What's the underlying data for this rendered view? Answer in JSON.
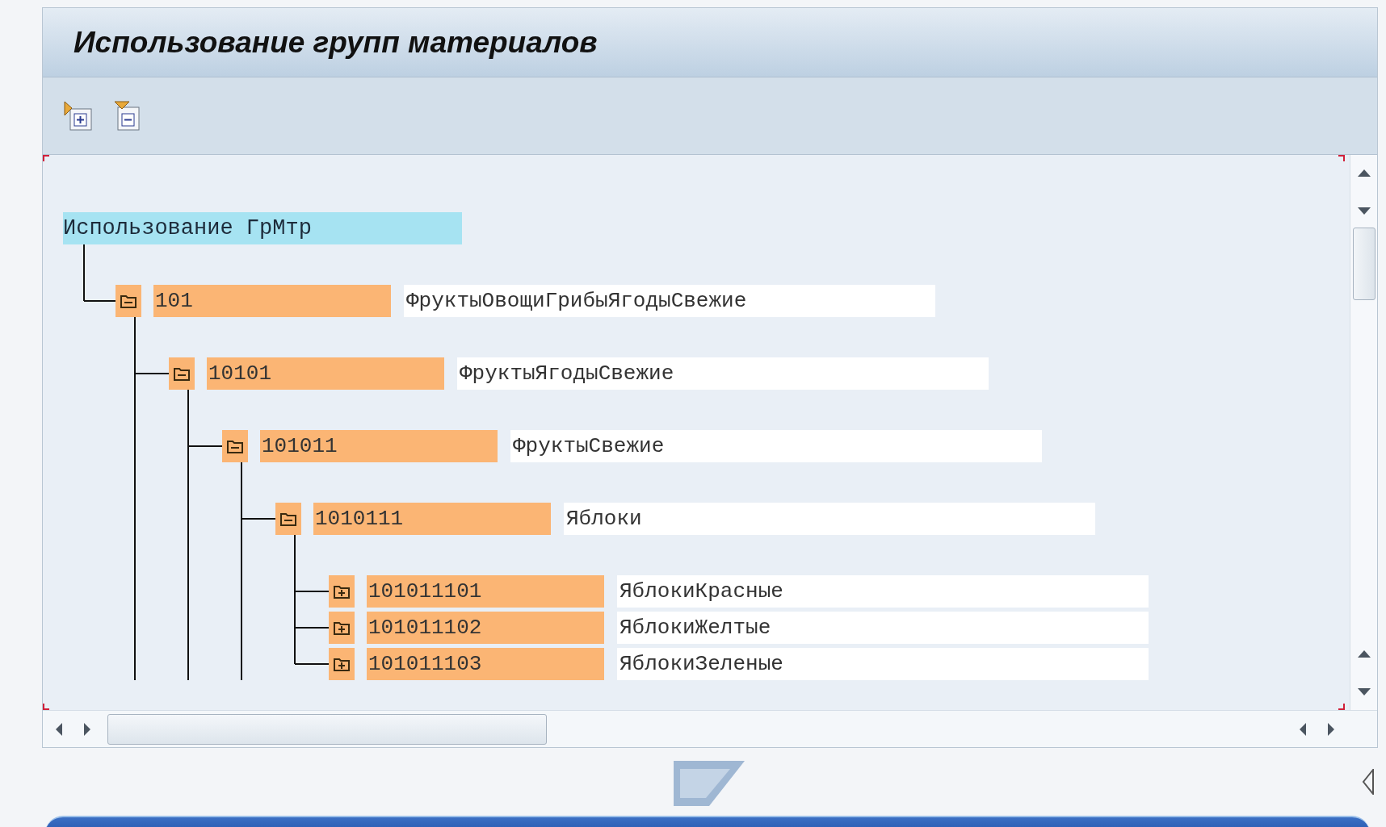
{
  "title": "Использование групп материалов",
  "toolbar": [
    {
      "kind": "expand"
    },
    {
      "kind": "collapse"
    }
  ],
  "tree": {
    "root": {
      "label": "Использование ГрМтр",
      "selected": true
    },
    "nodes": [
      {
        "code": "101",
        "description": "ФруктыОвощиГрибыЯгодыСвежие",
        "expanded": true,
        "more_below": true,
        "children": [
          {
            "code": "10101",
            "description": "ФруктыЯгодыСвежие",
            "expanded": true,
            "more_below": true,
            "children": [
              {
                "code": "101011",
                "description": "ФруктыСвежие",
                "expanded": true,
                "more_below": true,
                "children": [
                  {
                    "code": "1010111",
                    "description": "Яблоки",
                    "expanded": true,
                    "more_below": false,
                    "children": [
                      {
                        "code": "101011101",
                        "description": "ЯблокиКрасные",
                        "expanded": false,
                        "more_below": false
                      },
                      {
                        "code": "101011102",
                        "description": "ЯблокиЖелтые",
                        "expanded": false,
                        "more_below": false
                      },
                      {
                        "code": "101011103",
                        "description": "ЯблокиЗеленые",
                        "expanded": false,
                        "more_below": false
                      }
                    ]
                  }
                ]
              }
            ]
          }
        ]
      }
    ]
  }
}
